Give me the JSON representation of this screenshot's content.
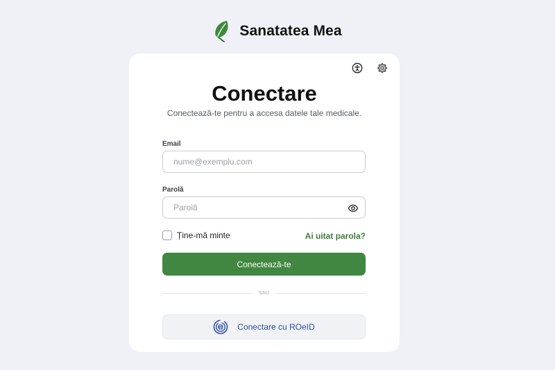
{
  "brand": {
    "name": "Sanatatea Mea",
    "logo": "leaf-icon",
    "logo_color": "#3f8a3a"
  },
  "header_icons": {
    "accessibility": "accessibility-icon",
    "settings": "gear-icon"
  },
  "login": {
    "title": "Conectare",
    "subtitle": "Conectează-te pentru a accesa datele tale medicale.",
    "email": {
      "label": "Email",
      "placeholder": "nume@exemplu.com",
      "value": ""
    },
    "password": {
      "label": "Parolă",
      "placeholder": "Parolă",
      "value": ""
    },
    "remember_me": {
      "label": "Ține-mă minte",
      "checked": false
    },
    "forgot_password": "Ai uitat parola?",
    "submit_label": "Conectează-te",
    "divider_text": "SAU",
    "roeid_label": "Conectare cu ROeID"
  },
  "colors": {
    "primary": "#418741",
    "link": "#3e7d3a",
    "roeid_text": "#2d4ea3",
    "background": "#f0f1f6"
  }
}
